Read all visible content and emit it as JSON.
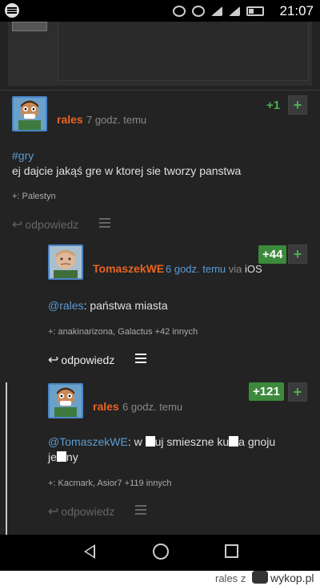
{
  "status_bar": {
    "time": "21:07",
    "icons": [
      "spotify-icon",
      "headphones-icon",
      "wifi-icon",
      "signal-icon",
      "signal-icon",
      "battery-icon"
    ]
  },
  "comments": [
    {
      "user": "rales",
      "time": "7 godz. temu",
      "votes": "+1",
      "tag": "#gry",
      "body": "ej dajcie jakąś gre w ktorej sie tworzy panstwa",
      "plusers": "+: Palestyn",
      "reply": "odpowiedz"
    },
    {
      "user": "TomaszekWE",
      "time": "6 godz. temu",
      "via": "via",
      "via_app": "iOS",
      "votes": "+44",
      "mention": "@rales",
      "body": ": państwa miasta",
      "plusers": "+: anakinarizona, Galactus +42 innych",
      "reply": "odpowiedz"
    },
    {
      "user": "rales",
      "time": "6 godz. temu",
      "votes": "+121",
      "mention": "@TomaszekWE",
      "body_parts": [
        ": w ",
        "uj smieszne ku",
        "a gnoju",
        "je",
        "ny"
      ],
      "plusers": "+: Kacmark, Asior7 +119 innych",
      "reply": "odpowiedz"
    }
  ],
  "plus_symbol": "+",
  "watermark": {
    "user": "rales",
    "z": "z",
    "site": "wykop.pl"
  },
  "colors": {
    "username": "#e8641f",
    "link": "#5b9bd5",
    "vote_green": "#4caf50",
    "background": "#232323"
  }
}
